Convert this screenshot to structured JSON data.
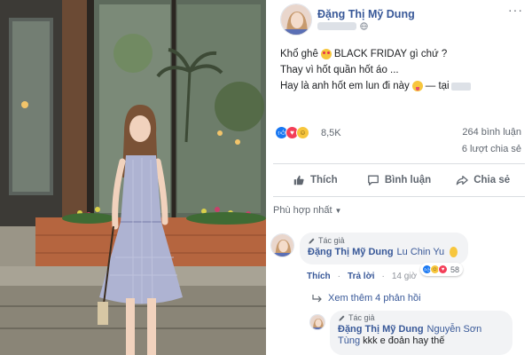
{
  "post": {
    "author": "Đặng Thị Mỹ Dung",
    "lines": [
      {
        "before": "Khổ ghê",
        "emoji": "heart-eyes-emoji",
        "after": "BLACK FRIDAY gì chứ ?"
      },
      {
        "before": "Thay vì hốt quần hốt áo ...",
        "emoji": "",
        "after": ""
      },
      {
        "before": "Hay là anh hốt em lun đi này",
        "emoji": "tongue-emoji",
        "after": "— tại"
      }
    ],
    "reaction_icons": [
      "like-icon",
      "love-icon",
      "haha-icon"
    ],
    "reaction_count": "8,5K",
    "comment_count": "264 bình luận",
    "share_count": "6 lượt chia sẻ"
  },
  "actions": {
    "like_label": "Thích",
    "comment_label": "Bình luận",
    "share_label": "Chia sẻ"
  },
  "sort": {
    "label": "Phù hợp nhất"
  },
  "comments": [
    {
      "badge": "Tác giả",
      "author": "Đặng Thị Mỹ Dung",
      "tag": "Lu Chin Yu",
      "reaction_count": "58",
      "like_label": "Thích",
      "reply_label": "Trả lời",
      "time": "14 giờ",
      "more_replies": "Xem thêm 4 phản hồi"
    },
    {
      "badge": "Tác giả",
      "author": "Đặng Thị Mỹ Dung",
      "tag": "Nguyễn Sơn",
      "tag_cont": "Tùng",
      "text": "kkk e đoản hay thế"
    }
  ],
  "colors": {
    "link_blue": "#385898",
    "like_blue": "#1877f2",
    "love_red": "#f33e58",
    "haha_yellow": "#f7c63d",
    "bubble_gray": "#f2f3f5",
    "divider": "#dadde1"
  }
}
